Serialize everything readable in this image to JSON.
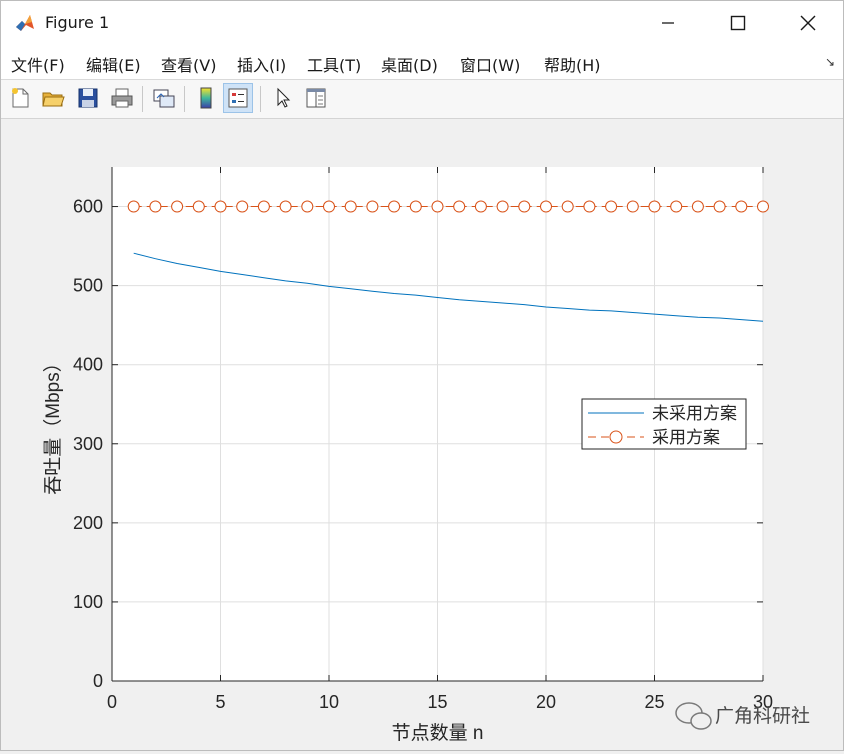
{
  "window": {
    "title": "Figure 1",
    "minimize_icon": "minimize-icon",
    "maximize_icon": "maximize-icon",
    "close_icon": "close-icon"
  },
  "menu": {
    "items": [
      "文件(F)",
      "编辑(E)",
      "查看(V)",
      "插入(I)",
      "工具(T)",
      "桌面(D)",
      "窗口(W)",
      "帮助(H)"
    ]
  },
  "toolbar": {
    "icons": [
      "new-figure-icon",
      "open-file-icon",
      "save-icon",
      "print-icon",
      "link-plot-icon",
      "colorbar-icon",
      "legend-icon",
      "pointer-icon",
      "property-editor-icon"
    ]
  },
  "chart_data": {
    "type": "line",
    "title": "",
    "xlabel": "节点数量 n",
    "ylabel": "吞吐量（Mbps）",
    "xlim": [
      0,
      30
    ],
    "ylim": [
      0,
      650
    ],
    "xticks": [
      0,
      5,
      10,
      15,
      20,
      25,
      30
    ],
    "yticks": [
      0,
      100,
      200,
      300,
      400,
      500,
      600
    ],
    "grid": true,
    "legend_position": "right",
    "series": [
      {
        "name": "未采用方案",
        "color": "#0072bd",
        "marker": "none",
        "line_style": "solid",
        "x": [
          1,
          2,
          3,
          4,
          5,
          6,
          7,
          8,
          9,
          10,
          11,
          12,
          13,
          14,
          15,
          16,
          17,
          18,
          19,
          20,
          21,
          22,
          23,
          24,
          25,
          26,
          27,
          28,
          29,
          30
        ],
        "y": [
          541,
          534,
          528,
          523,
          518,
          514,
          510,
          506,
          503,
          499,
          496,
          493,
          490,
          488,
          485,
          482,
          480,
          478,
          476,
          473,
          471,
          469,
          468,
          466,
          464,
          462,
          460,
          459,
          457,
          455
        ]
      },
      {
        "name": "采用方案",
        "color": "#d95319",
        "marker": "circle",
        "line_style": "dashed",
        "x": [
          1,
          2,
          3,
          4,
          5,
          6,
          7,
          8,
          9,
          10,
          11,
          12,
          13,
          14,
          15,
          16,
          17,
          18,
          19,
          20,
          21,
          22,
          23,
          24,
          25,
          26,
          27,
          28,
          29,
          30
        ],
        "y": [
          600,
          600,
          600,
          600,
          600,
          600,
          600,
          600,
          600,
          600,
          600,
          600,
          600,
          600,
          600,
          600,
          600,
          600,
          600,
          600,
          600,
          600,
          600,
          600,
          600,
          600,
          600,
          600,
          600,
          600
        ]
      }
    ]
  },
  "watermark": {
    "text": "广角科研社",
    "logo_icon": "wechat-logo-icon"
  }
}
